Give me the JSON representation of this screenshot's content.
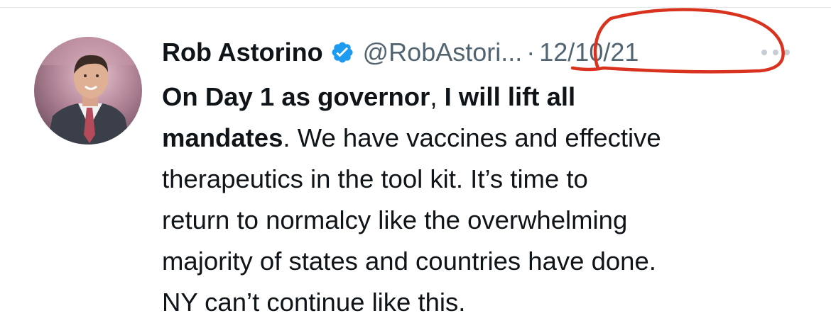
{
  "tweet": {
    "author": {
      "display_name": "Rob Astorino",
      "handle": "@RobAstori...",
      "verified": true,
      "verified_icon": "verified-badge-icon",
      "avatar": "profile-photo"
    },
    "separator": "·",
    "timestamp": "12/10/21",
    "more_icon": "more-options-icon",
    "text": {
      "bold_1": "On Day 1 as governor",
      "comma": ", ",
      "bold_2": "I will lift all",
      "bold_3": "mandates",
      "line2_rest": ". We have vaccines and effective",
      "line3": "therapeutics in the tool kit. It’s time to",
      "line4": "return to normalcy like the overwhelming",
      "line5": "majority of states and countries have done.",
      "line6": "NY can’t continue like this."
    },
    "colors": {
      "verified": "#1d9bf0",
      "secondary_text": "#536471",
      "annotation": "#d9321f"
    }
  }
}
